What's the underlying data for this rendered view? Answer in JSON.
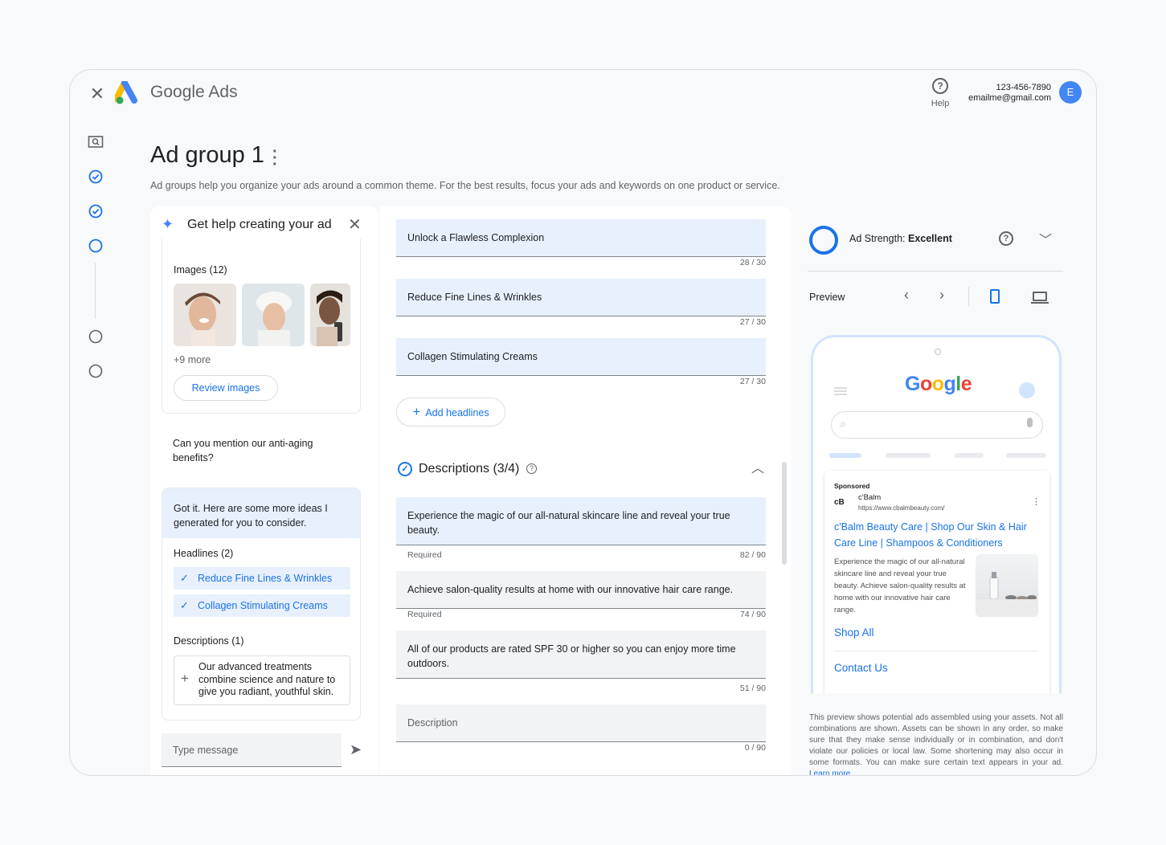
{
  "header": {
    "brand_google": "Google",
    "brand_ads": "Ads",
    "help_label": "Help",
    "account_phone": "123-456-7890",
    "account_email": "emailme@gmail.com",
    "avatar_initial": "E"
  },
  "page": {
    "title": "Ad group 1",
    "subtitle": "Ad groups help you organize your ads around a common theme. For the best results, focus your ads and keywords on one product or service."
  },
  "chat": {
    "title": "Get help creating your ad",
    "images_label": "Images (12)",
    "images_more": "+9 more",
    "review_images": "Review images",
    "user_message": "Can you mention our anti-aging benefits?",
    "ai_reply": "Got it. Here are some more ideas I generated for you to consider.",
    "headlines_label": "Headlines (2)",
    "headlines": [
      "Reduce Fine Lines & Wrinkles",
      "Collagen Stimulating Creams"
    ],
    "descriptions_label": "Descriptions (1)",
    "description_suggestion": "Our advanced treatments combine science and nature to give you radiant, youthful skin.",
    "input_placeholder": "Type message"
  },
  "form": {
    "headlines": [
      {
        "text": "Unlock a Flawless Complexion",
        "count": "28 / 30"
      },
      {
        "text": "Reduce Fine Lines & Wrinkles",
        "count": "27 / 30"
      },
      {
        "text": "Collagen Stimulating Creams",
        "count": "27 / 30"
      }
    ],
    "add_headlines": "Add headlines",
    "descriptions_title": "Descriptions (3/4)",
    "descriptions": [
      {
        "text": "Experience the magic of our all-natural skincare line and reveal your true beauty.",
        "note": "Required",
        "count": "82 / 90"
      },
      {
        "text": "Achieve salon-quality results at home with our innovative hair care range.",
        "note": "Required",
        "count": "74 / 90"
      },
      {
        "text": "All of our products are rated SPF 30 or higher so you can enjoy more time outdoors.",
        "note": "",
        "count": "51 / 90"
      }
    ],
    "description_placeholder": "Description",
    "description_empty_count": "0 / 90"
  },
  "preview": {
    "strength_label": "Ad Strength:",
    "strength_value": "Excellent",
    "preview_label": "Preview",
    "google_logo": "Google",
    "sponsored": "Sponsored",
    "advertiser_logo": "cB",
    "advertiser_name": "c'Balm",
    "advertiser_url": "https://www.cbalmbeauty.com/",
    "ad_title": "c'Balm Beauty Care | Shop Our Skin & Hair Care Line | Shampoos & Conditioners",
    "ad_description": "Experience the magic of our all-natural skincare line and reveal your true beauty. Achieve salon-quality results at home with our innovative hair care range.",
    "sitelinks": [
      "Shop All",
      "Contact Us"
    ],
    "disclaimer": "This preview shows potential ads assembled using your assets. Not all combinations are shown. Assets can be shown in any order, so make sure that they make sense individually or in combination, and don't violate our policies or local law. Some shortening may also occur in some formats. You can make sure certain text appears in your ad.",
    "learn_more": "Learn more"
  },
  "colors": {
    "accent": "#1a73e8",
    "chip_bg": "#e8f0fe"
  }
}
